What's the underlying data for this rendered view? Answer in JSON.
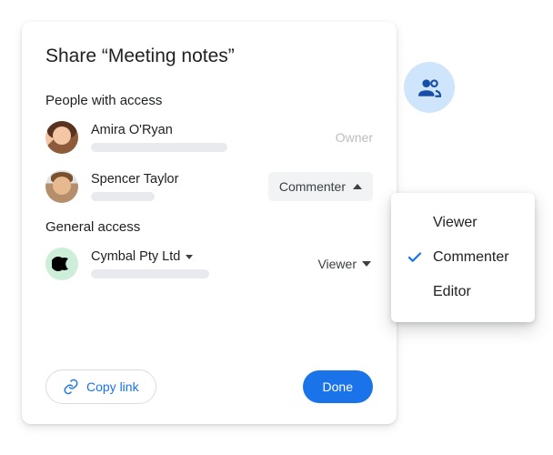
{
  "dialog": {
    "title": "Share “Meeting notes”",
    "people_section_label": "People with access",
    "general_section_label": "General access",
    "copy_link_label": "Copy link",
    "done_label": "Done"
  },
  "people": [
    {
      "name": "Amira O'Ryan",
      "role_label": "Owner",
      "role_kind": "static"
    },
    {
      "name": "Spencer Taylor",
      "role_label": "Commenter",
      "role_kind": "chip-open"
    }
  ],
  "general": {
    "org_name": "Cymbal Pty Ltd",
    "role_label": "Viewer"
  },
  "role_menu": {
    "options": [
      "Viewer",
      "Commenter",
      "Editor"
    ],
    "selected": "Commenter"
  },
  "colors": {
    "primary": "#1a73e8",
    "muted": "#bdbdbd",
    "chip_bg": "#f1f3f4",
    "badge_bg": "#cfe5fb"
  }
}
